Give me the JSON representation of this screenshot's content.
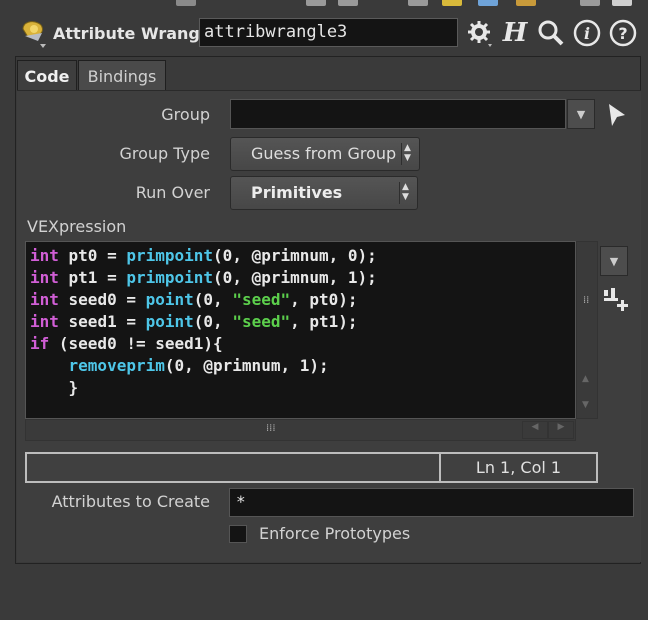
{
  "header": {
    "node_type_label": "Attribute Wrangle",
    "node_name": "attribwrangle3",
    "buttons": {
      "gear": "gear-icon",
      "help_h": "H",
      "search": "search-icon",
      "info": "i",
      "help": "?"
    }
  },
  "tabs": [
    {
      "label": "Code",
      "active": true
    },
    {
      "label": "Bindings",
      "active": false
    }
  ],
  "params": {
    "group_label": "Group",
    "group_value": "",
    "group_type_label": "Group Type",
    "group_type_value": "Guess from Group",
    "run_over_label": "Run Over",
    "run_over_value": "Primitives",
    "vex_label": "VEXpression",
    "attrs_label": "Attributes to Create",
    "attrs_value": "*",
    "enforce_label": "Enforce Prototypes",
    "enforce_checked": false
  },
  "code": [
    [
      {
        "t": "int",
        "c": "kw"
      },
      {
        "t": " pt0 = "
      },
      {
        "t": "primpoint",
        "c": "fn"
      },
      {
        "t": "(0, @primnum, 0);"
      }
    ],
    [
      {
        "t": "int",
        "c": "kw"
      },
      {
        "t": " pt1 = "
      },
      {
        "t": "primpoint",
        "c": "fn"
      },
      {
        "t": "(0, @primnum, 1);"
      }
    ],
    [
      {
        "t": "int",
        "c": "kw"
      },
      {
        "t": " seed0 = "
      },
      {
        "t": "point",
        "c": "fn"
      },
      {
        "t": "(0, "
      },
      {
        "t": "\"seed\"",
        "c": "str"
      },
      {
        "t": ", pt0);"
      }
    ],
    [
      {
        "t": "int",
        "c": "kw"
      },
      {
        "t": " seed1 = "
      },
      {
        "t": "point",
        "c": "fn"
      },
      {
        "t": "(0, "
      },
      {
        "t": "\"seed\"",
        "c": "str"
      },
      {
        "t": ", pt1);"
      }
    ],
    [
      {
        "t": "if",
        "c": "kw"
      },
      {
        "t": " (seed0 != seed1){"
      }
    ],
    [
      {
        "t": "    "
      },
      {
        "t": "removeprim",
        "c": "fn"
      },
      {
        "t": "(0, @primnum, 1);"
      }
    ],
    [
      {
        "t": "    }"
      }
    ]
  ],
  "status": {
    "left": "",
    "cursor_position": "Ln 1, Col 1"
  },
  "colors": {
    "keyword": "#d15ed6",
    "function": "#4ec6e8",
    "string": "#5ccf4c",
    "background": "#3a3a3a"
  }
}
